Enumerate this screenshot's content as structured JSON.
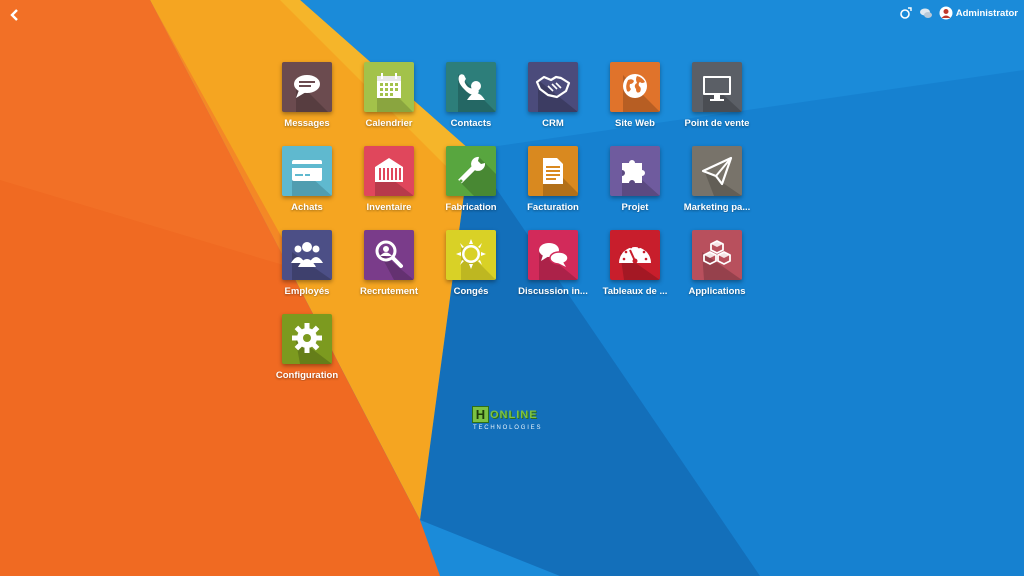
{
  "topbar": {
    "back_icon": "chevron-left-icon",
    "right_icons": [
      "odoo-icon",
      "chat-icon"
    ],
    "user": {
      "avatar_icon": "user-avatar-icon",
      "name": "Administrator"
    }
  },
  "apps": [
    {
      "label": "Messages",
      "icon": "speech-bubble-icon",
      "color": "#6b4b4f"
    },
    {
      "label": "Calendrier",
      "icon": "calendar-icon",
      "color": "#a3c24a"
    },
    {
      "label": "Contacts",
      "icon": "contacts-icon",
      "color": "#2d7e7a"
    },
    {
      "label": "CRM",
      "icon": "handshake-icon",
      "color": "#4b4b7b"
    },
    {
      "label": "Site Web",
      "icon": "globe-icon",
      "color": "#e0732b"
    },
    {
      "label": "Point de vente",
      "icon": "monitor-icon",
      "color": "#5b5f66"
    },
    {
      "label": "Achats",
      "icon": "credit-card-icon",
      "color": "#5fb9cf"
    },
    {
      "label": "Inventaire",
      "icon": "warehouse-icon",
      "color": "#e0475c"
    },
    {
      "label": "Fabrication",
      "icon": "wrench-icon",
      "color": "#58a63f"
    },
    {
      "label": "Facturation",
      "icon": "document-icon",
      "color": "#d9891f"
    },
    {
      "label": "Projet",
      "icon": "puzzle-icon",
      "color": "#6f5b9e"
    },
    {
      "label": "Marketing pa...",
      "icon": "paper-plane-icon",
      "color": "#78736a"
    },
    {
      "label": "Employés",
      "icon": "users-icon",
      "color": "#4c4f86"
    },
    {
      "label": "Recrutement",
      "icon": "magnifier-icon",
      "color": "#7a3c8a"
    },
    {
      "label": "Congés",
      "icon": "sun-icon",
      "color": "#d9d126"
    },
    {
      "label": "Discussion in...",
      "icon": "chat-bubbles-icon",
      "color": "#d22a5a"
    },
    {
      "label": "Tableaux de ...",
      "icon": "gauge-icon",
      "color": "#c81e2c"
    },
    {
      "label": "Applications",
      "icon": "cubes-icon",
      "color": "#b8505d"
    },
    {
      "label": "Configuration",
      "icon": "gear-icon",
      "color": "#7c9a1f"
    }
  ],
  "logo": {
    "mark": "H",
    "word": "ONLINE",
    "sub": "TECHNOLOGIES"
  },
  "background_colors": {
    "orange": "#f06a23",
    "amber": "#f4a020",
    "blue": "#1a8ad8",
    "dark_blue": "#1270b8"
  }
}
